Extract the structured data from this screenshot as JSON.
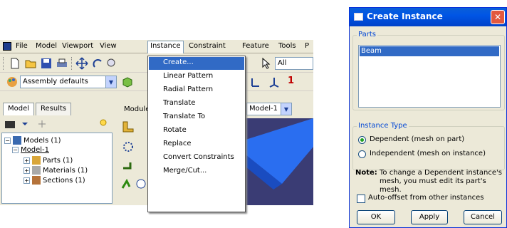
{
  "menubar": {
    "items": [
      "File",
      "Model",
      "Viewport",
      "View",
      "Instance",
      "Constraint",
      "Feature",
      "Tools",
      "P"
    ]
  },
  "toolbar2": {
    "filter_value": "All"
  },
  "toolbar3": {
    "defaults_value": "Assembly defaults",
    "axis_text": "1"
  },
  "context": {
    "module_label": "Module",
    "model_value": "Model-1"
  },
  "tabs": {
    "model": "Model",
    "results": "Results"
  },
  "tree": {
    "models": "Models (1)",
    "model1": "Model-1",
    "parts": "Parts (1)",
    "materials": "Materials (1)",
    "sections": "Sections (1)"
  },
  "instance_menu": {
    "items": [
      "Create...",
      "Linear Pattern",
      "Radial Pattern",
      "Translate",
      "Translate To",
      "Rotate",
      "Replace",
      "Convert Constraints",
      "Merge/Cut..."
    ],
    "selected": "Create..."
  },
  "dialog": {
    "title": "Create Instance",
    "close_glyph": "✕",
    "parts_legend": "Parts",
    "parts_list": [
      "Beam"
    ],
    "instance_type_legend": "Instance Type",
    "option_dependent": "Dependent (mesh on part)",
    "option_independent": "Independent (mesh on instance)",
    "note_label": "Note:",
    "note_text": "To change a Dependent instance's mesh, you must edit its part's mesh.",
    "auto_offset_label": "Auto-offset from other instances",
    "ok": "OK",
    "apply": "Apply",
    "cancel": "Cancel"
  }
}
